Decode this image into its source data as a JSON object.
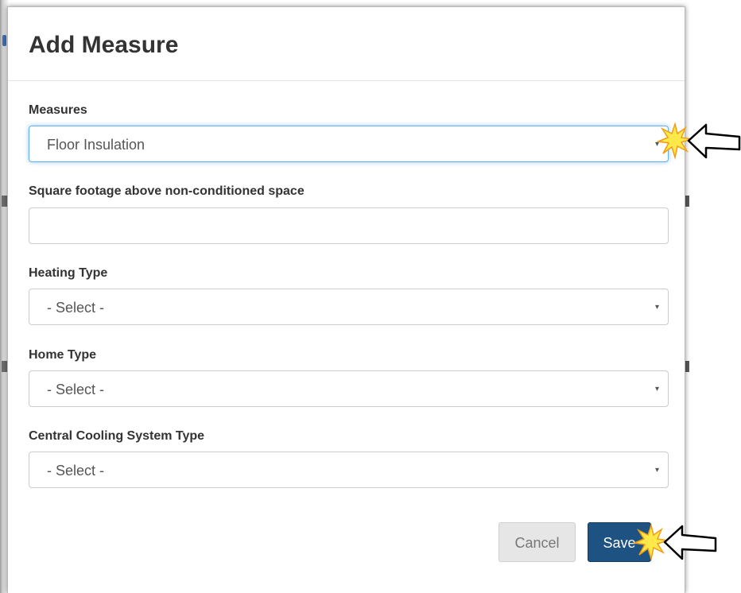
{
  "dialog": {
    "title": "Add Measure"
  },
  "fields": {
    "measures": {
      "label": "Measures",
      "value": "Floor Insulation",
      "caret": "▾"
    },
    "square_footage": {
      "label": "Square footage above non-conditioned space",
      "value": ""
    },
    "heating_type": {
      "label": "Heating Type",
      "value": "- Select -",
      "caret": "▾"
    },
    "home_type": {
      "label": "Home Type",
      "value": "- Select -",
      "caret": "▾"
    },
    "central_cooling": {
      "label": "Central Cooling System Type",
      "value": "- Select -",
      "caret": "▾"
    }
  },
  "buttons": {
    "cancel_label": "Cancel",
    "save_label": "Save"
  },
  "colors": {
    "save_button": "#1e5283",
    "focus_border": "#66afe9",
    "highlight_burst": "#ffe94a",
    "text": "#333333"
  },
  "icons": {
    "dropdown_caret": "chevron-down-icon",
    "annotation_pointer": "pointer-arrow-icon",
    "annotation_burst": "highlight-burst-icon"
  }
}
